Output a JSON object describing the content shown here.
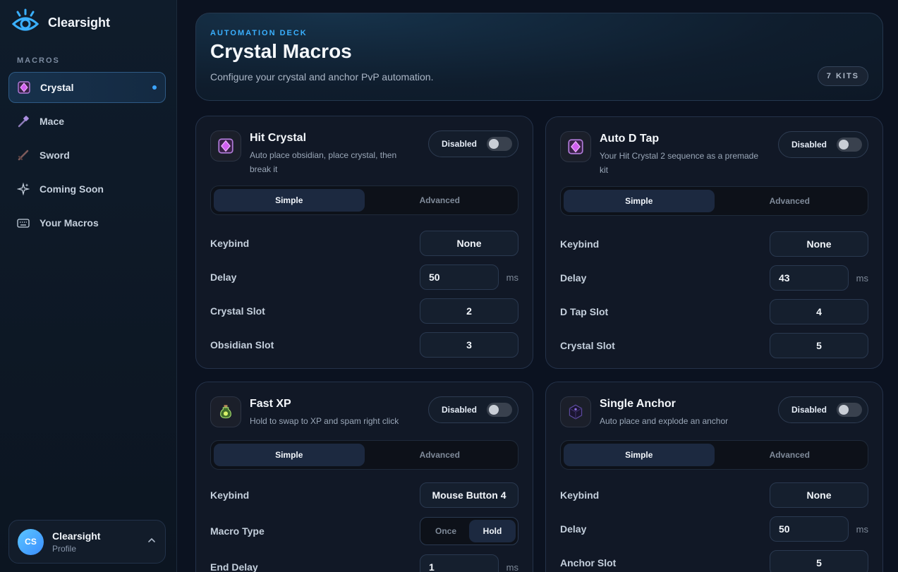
{
  "app": {
    "name": "Clearsight"
  },
  "sidebar": {
    "section_label": "MACROS",
    "items": [
      {
        "label": "Crystal",
        "icon": "crystal-icon",
        "active": true
      },
      {
        "label": "Mace",
        "icon": "mace-icon"
      },
      {
        "label": "Sword",
        "icon": "sword-icon"
      },
      {
        "label": "Coming Soon",
        "icon": "sparkle-icon"
      },
      {
        "label": "Your Macros",
        "icon": "keyboard-icon"
      }
    ],
    "profile": {
      "initials": "CS",
      "name": "Clearsight",
      "sub": "Profile"
    }
  },
  "header": {
    "kicker": "AUTOMATION DECK",
    "title": "Crystal Macros",
    "subtitle": "Configure your crystal and anchor PvP automation.",
    "badge": "7 KITS"
  },
  "colors": {
    "accent": "#3ab0ff",
    "active_nav_border": "#2e5a85",
    "card_bg": "#111826"
  },
  "mode_tabs": {
    "simple": "Simple",
    "advanced": "Advanced"
  },
  "cards": [
    {
      "title": "Hit Crystal",
      "desc": "Auto place obsidian, place crystal, then break it",
      "status": "Disabled",
      "rows": [
        {
          "label": "Keybind",
          "value": "None"
        },
        {
          "label": "Delay",
          "value": "50",
          "unit": "ms"
        },
        {
          "label": "Crystal Slot",
          "value": "2"
        },
        {
          "label": "Obsidian Slot",
          "value": "3"
        }
      ]
    },
    {
      "title": "Auto D Tap",
      "desc": "Your Hit Crystal 2 sequence as a premade kit",
      "status": "Disabled",
      "rows": [
        {
          "label": "Keybind",
          "value": "None"
        },
        {
          "label": "Delay",
          "value": "43",
          "unit": "ms"
        },
        {
          "label": "D Tap Slot",
          "value": "4"
        },
        {
          "label": "Crystal Slot",
          "value": "5"
        }
      ]
    },
    {
      "title": "Fast XP",
      "desc": "Hold to swap to XP and spam right click",
      "status": "Disabled",
      "rows": [
        {
          "label": "Keybind",
          "value": "Mouse Button 4"
        },
        {
          "label": "Macro Type",
          "options": [
            "Once",
            "Hold"
          ],
          "selected": "Hold"
        },
        {
          "label": "End Delay",
          "value": "1",
          "unit": "ms"
        }
      ]
    },
    {
      "title": "Single Anchor",
      "desc": "Auto place and explode an anchor",
      "status": "Disabled",
      "rows": [
        {
          "label": "Keybind",
          "value": "None"
        },
        {
          "label": "Delay",
          "value": "50",
          "unit": "ms"
        },
        {
          "label": "Anchor Slot",
          "value": "5"
        }
      ]
    }
  ]
}
